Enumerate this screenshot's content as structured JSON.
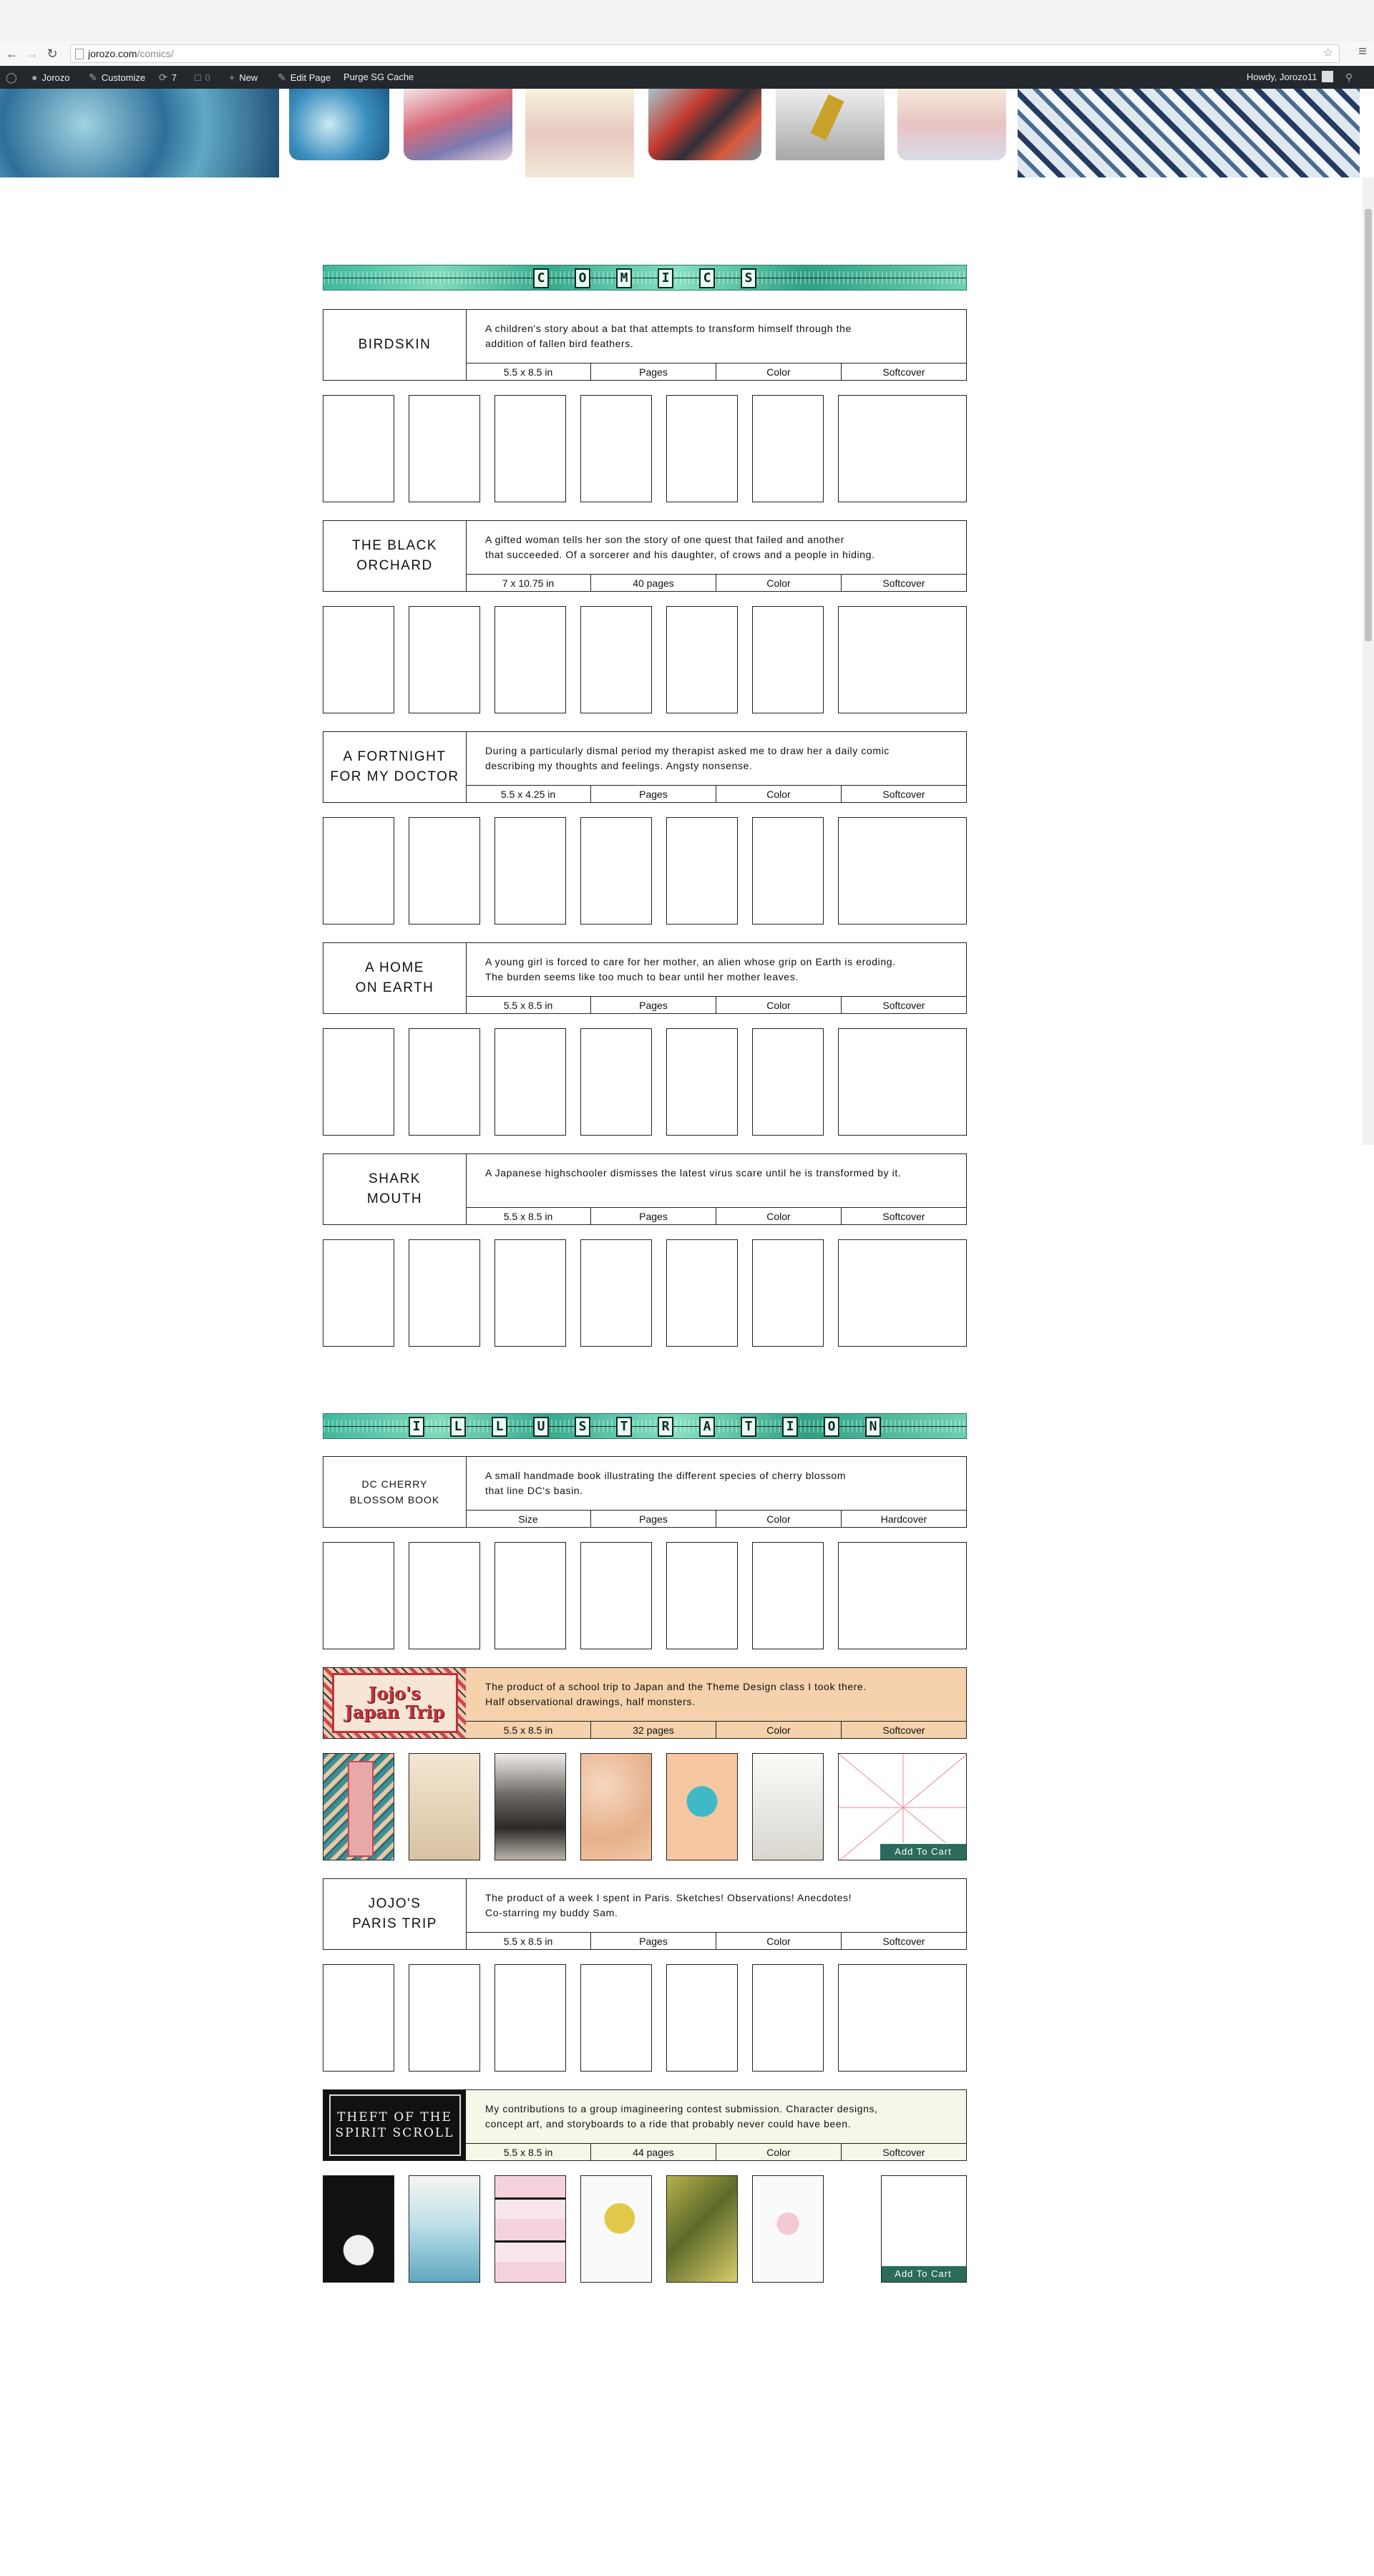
{
  "browser": {
    "url_host": "jorozo.com",
    "url_path": "/comics/"
  },
  "admin_bar": {
    "site_name": "Jorozo",
    "customize": "Customize",
    "updates_count": "7",
    "comments_count": "0",
    "new_label": "New",
    "edit_page": "Edit Page",
    "purge_cache": "Purge SG Cache",
    "howdy": "Howdy, Jorozo11"
  },
  "sections": {
    "comics_letters": [
      "C",
      "O",
      "M",
      "I",
      "C",
      "S"
    ],
    "illustration_letters": [
      "I",
      "L",
      "L",
      "U",
      "S",
      "T",
      "R",
      "A",
      "T",
      "I",
      "O",
      "N"
    ]
  },
  "products": [
    {
      "title": "BIRDSKIN",
      "description": "A children's story about a bat that attempts to transform himself through the\naddition of fallen bird feathers.",
      "size": "5.5 x 8.5 in",
      "pages": "Pages",
      "color": "Color",
      "binding": "Softcover"
    },
    {
      "title": "THE BLACK\nORCHARD",
      "description": "A gifted woman tells her son the story of one quest that failed and another\nthat succeeded. Of a sorcerer and his daughter, of crows and a people in hiding.",
      "size": "7 x 10.75 in",
      "pages": "40 pages",
      "color": "Color",
      "binding": "Softcover"
    },
    {
      "title": "A FORTNIGHT\nFOR MY DOCTOR",
      "description": "During a particularly dismal period my therapist asked me to draw her a daily comic\ndescribing my thoughts and feelings. Angsty nonsense.",
      "size": "5.5 x 4.25 in",
      "pages": "Pages",
      "color": "Color",
      "binding": "Softcover"
    },
    {
      "title": "A HOME\nON EARTH",
      "description": "A young girl is forced to care for her mother, an alien whose grip on Earth is eroding.\nThe burden seems like too much to bear until her mother leaves.",
      "size": "5.5 x 8.5 in",
      "pages": "Pages",
      "color": "Color",
      "binding": "Softcover"
    },
    {
      "title": "SHARK\nMOUTH",
      "description": "A Japanese highschooler dismisses the latest virus scare until he is transformed by it.",
      "size": "5.5 x 8.5 in",
      "pages": "Pages",
      "color": "Color",
      "binding": "Softcover"
    },
    {
      "title": "DC CHERRY\nBLOSSOM BOOK",
      "description": "A small handmade book illustrating the different species of cherry blossom\nthat line DC's basin.",
      "size": "Size",
      "pages": "Pages",
      "color": "Color",
      "binding": "Hardcover"
    },
    {
      "title": "Jojo's Japan Trip",
      "logo_line1": "Jojo's",
      "logo_line2": "Japan Trip",
      "description": "The product of a school trip to Japan and the Theme Design class I took there.\nHalf observational drawings, half monsters.",
      "size": "5.5 x 8.5 in",
      "pages": "32 pages",
      "color": "Color",
      "binding": "Softcover",
      "add_to_cart": "Add To Cart"
    },
    {
      "title": "JOJO'S\nPARIS TRIP",
      "description": "The product of a week I spent in Paris. Sketches! Observations! Anecdotes!\nCo-starring my buddy Sam.",
      "size": "5.5 x 8.5 in",
      "pages": "Pages",
      "color": "Color",
      "binding": "Softcover"
    },
    {
      "title": "Theft of the Spirit Scroll",
      "logo_line1": "THEFT OF THE",
      "logo_line2": "SPIRIT SCROLL",
      "description": "My contributions to a group imagineering contest submission. Character designs,\nconcept art, and storyboards to a ride that probably never could have been.",
      "size": "5.5 x 8.5 in",
      "pages": "44 pages",
      "color": "Color",
      "binding": "Softcover",
      "add_to_cart": "Add To Cart"
    }
  ]
}
